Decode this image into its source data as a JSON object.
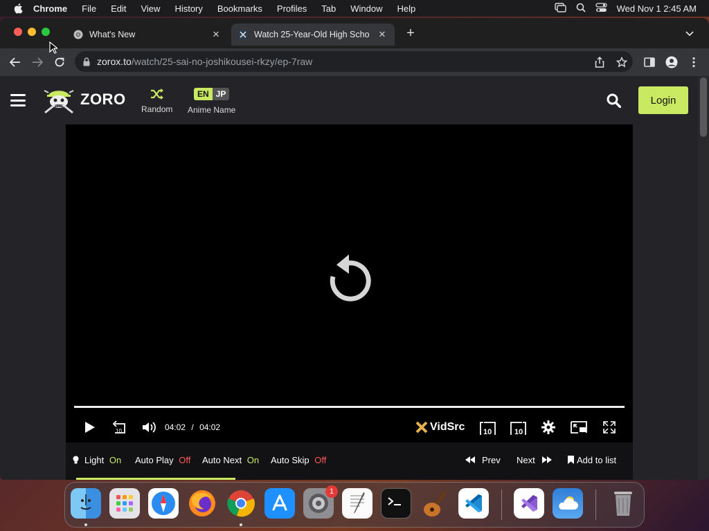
{
  "menubar": {
    "app": "Chrome",
    "items": [
      "File",
      "Edit",
      "View",
      "History",
      "Bookmarks",
      "Profiles",
      "Tab",
      "Window",
      "Help"
    ],
    "clock": "Wed Nov 1  2:45 AM"
  },
  "browser": {
    "tabs": [
      {
        "title": "What's New",
        "icon": "chrome-icon"
      },
      {
        "title": "Watch 25-Year-Old High Scho",
        "icon": "zoro-favicon"
      }
    ],
    "url_host": "zorox.to",
    "url_path": "/watch/25-sai-no-joshikousei-rkzy/ep-7raw"
  },
  "site": {
    "logo": "ZORO",
    "nav": {
      "random_label": "Random",
      "lang_en": "EN",
      "lang_jp": "JP",
      "anime_name_label": "Anime Name"
    },
    "login_label": "Login"
  },
  "player": {
    "current_time": "04:02",
    "separator": "/",
    "duration": "04:02",
    "progress": 1.0,
    "brand": "VidSrc",
    "skip_back": "10",
    "skip_fwd": "10"
  },
  "options": {
    "light_label": "Light",
    "light_state": "On",
    "autoplay_label": "Auto Play",
    "autoplay_state": "Off",
    "autonext_label": "Auto Next",
    "autonext_state": "On",
    "autoskip_label": "Auto Skip",
    "autoskip_state": "Off",
    "prev_label": "Prev",
    "next_label": "Next",
    "addlist_label": "Add to list"
  },
  "dock": {
    "apps": [
      "Finder",
      "Launchpad",
      "Safari",
      "Firefox",
      "Chrome",
      "App Store",
      "System Settings",
      "TextEdit",
      "Terminal",
      "GarageBand",
      "Visual Studio Code",
      "Visual Studio",
      "Weather",
      "Trash"
    ],
    "settings_badge": "1"
  },
  "colors": {
    "accent": "#cae962",
    "off_red": "#ff5a5a",
    "site_bg": "#242428"
  }
}
